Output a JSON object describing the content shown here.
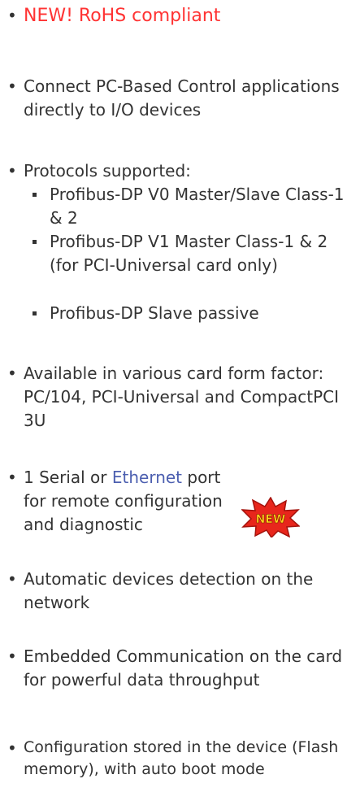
{
  "features": [
    {
      "text": "NEW! RoHS compliant"
    },
    {
      "text": "Connect PC-Based Control applications directly to I/O devices"
    },
    {
      "text": "Protocols supported:",
      "subitems": [
        "Profibus-DP V0 Master/Slave Class-1 & 2",
        "Profibus-DP V1 Master Class-1 & 2 (for PCI-Universal card only)",
        "Profibus-DP Slave passive"
      ]
    },
    {
      "text": "Available in various card form factor: PC/104, PCI-Universal and CompactPCI 3U"
    },
    {
      "text_before": "1 Serial or ",
      "link": "Ethernet",
      "text_after": " port for remote configuration and diagnostic",
      "badge": "NEW"
    },
    {
      "text": "Automatic devices detection on the network"
    },
    {
      "text": "Embedded Communication on the card for powerful data throughput"
    },
    {
      "text": "Configuration stored in the device (Flash memory), with auto boot mode"
    }
  ],
  "bullet_char": "•",
  "colors": {
    "text": "#333333",
    "highlight": "#ff3333",
    "link": "#4c5fb0",
    "badge_fill": "#e8261c",
    "badge_text": "#ffd21a"
  }
}
